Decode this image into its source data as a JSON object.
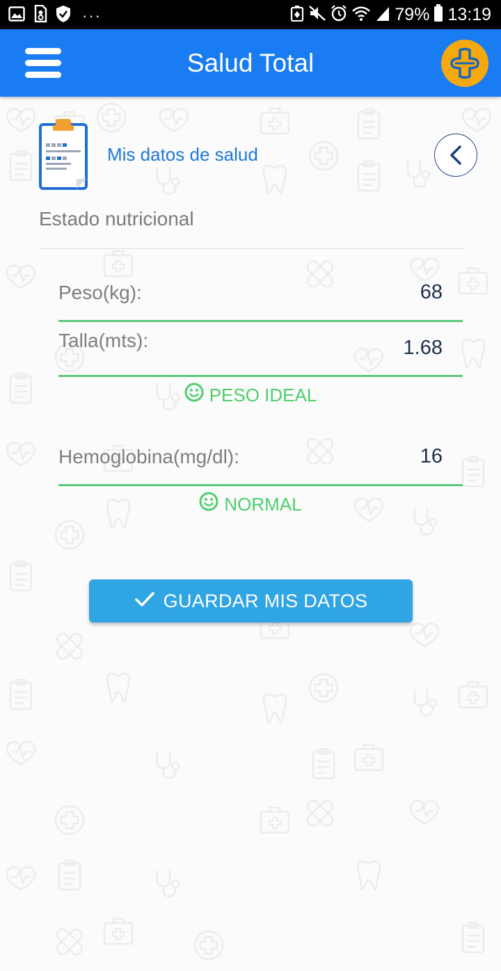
{
  "status_bar": {
    "battery": "79%",
    "time": "13:19",
    "more": "···",
    "icons": [
      "image-icon",
      "sim-icon",
      "shield-icon",
      "more-icon",
      "data-saver-icon",
      "mute-icon",
      "alarm-icon",
      "wifi-icon",
      "signal-icon",
      "battery-icon"
    ]
  },
  "app_bar": {
    "title": "Salud Total",
    "menu_icon": "hamburger-menu-icon",
    "brand_icon": "medical-cross-icon"
  },
  "header": {
    "section_title": "Mis datos de salud",
    "section_icon": "clipboard-icon",
    "back_icon": "chevron-left-icon",
    "subsection_title": "Estado nutricional"
  },
  "fields": {
    "peso": {
      "label": "Peso(kg):",
      "value": "68"
    },
    "talla": {
      "label": "Talla(mts):",
      "value": "1.68"
    },
    "hemoglobina": {
      "label": "Hemoglobina(mg/dl):",
      "value": "16"
    }
  },
  "results": {
    "peso": {
      "text": "PESO IDEAL",
      "icon": "smiley-icon"
    },
    "hemoglobina": {
      "text": "NORMAL",
      "icon": "smiley-icon"
    }
  },
  "actions": {
    "save_label": "GUARDAR MIS DATOS",
    "save_icon": "checkmark-icon"
  },
  "colors": {
    "app_bar": "#1a7cf2",
    "brand": "#f5a90f",
    "accent_text": "#1e78d7",
    "success": "#4ccf6b",
    "field_line": "#5cc878",
    "button": "#2fa5e4",
    "value_text": "#1d2f4a"
  }
}
